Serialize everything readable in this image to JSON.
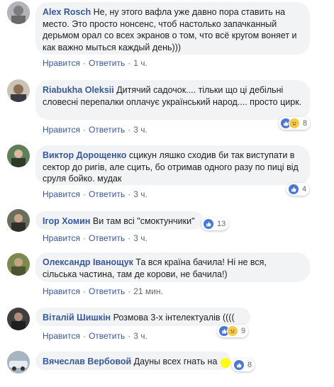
{
  "comments": [
    {
      "author": "Alex Rosch",
      "text": "Не, ну этого вафла уже давно пора ставить на место. Это просто нонсенс, чтоб настолько запачканный дерьмом орал со всех экранов о том, что всё кругом воняет и как важно мыться каждый день)))",
      "like": "Нравится",
      "reply": "Ответить",
      "time": "1 ч.",
      "reaction_count": ""
    },
    {
      "author": "Riabukha Oleksii",
      "text": "Дитячий садочок.... тільки що ці дебільні словесні перепалки оплачує український народ.... просто цирк.",
      "like": "Нравится",
      "reply": "Ответить",
      "time": "3 ч.",
      "reaction_count": "8"
    },
    {
      "author": "Виктор Дорощенко",
      "text": "сцикун ляшко сходив би так виступати в сектор до ригів, але сцить, бо отримав одного разу по пиці від сруля бойко. мудак",
      "like": "Нравится",
      "reply": "Ответить",
      "time": "3 ч.",
      "reaction_count": "4"
    },
    {
      "author": "Ігор Хомин",
      "text": "Ви там всі \"смоктунчики\"",
      "like": "Нравится",
      "reply": "Ответить",
      "time": "3 ч.",
      "reaction_count": "13"
    },
    {
      "author": "Олександр Іванощук",
      "text": "Та вся країна бачила! Ні не вся, сільська частина, там де корови, не бачила!)",
      "like": "Нравится",
      "reply": "Ответить",
      "time": "21 мин.",
      "reaction_count": ""
    },
    {
      "author": "Віталій Шишкін",
      "text": "Розмова 3-х інтелектуалів ((((",
      "like": "Нравится",
      "reply": "Ответить",
      "time": "3 ч.",
      "reaction_count": "9"
    },
    {
      "author": "Вячеслав Вербовой",
      "text": "Дауны всех гнать на",
      "like": "",
      "reply": "",
      "time": "",
      "reaction_count": "8"
    }
  ],
  "colors": {
    "author": "#385898",
    "bubble": "#f2f3f5",
    "meta": "#606770",
    "like_reaction": "#4a76d6",
    "sad_reaction": "#f7c84b"
  },
  "icons": {
    "like": "thumbs-up-icon",
    "sad": "sad-face-icon"
  }
}
